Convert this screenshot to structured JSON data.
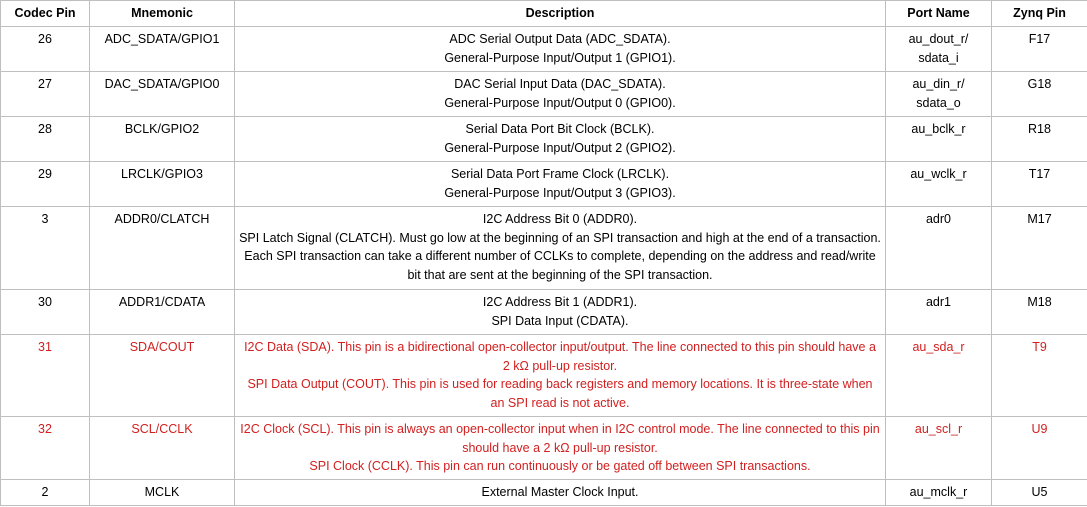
{
  "headers": [
    "Codec Pin",
    "Mnemonic",
    "Description",
    "Port Name",
    "Zynq Pin"
  ],
  "rows": [
    {
      "pin": "26",
      "mnemonic": "ADC_SDATA/GPIO1",
      "desc": [
        "ADC Serial Output Data (ADC_SDATA).",
        "General-Purpose Input/Output 1 (GPIO1)."
      ],
      "port": [
        "au_dout_r/",
        "sdata_i"
      ],
      "zynq": "F17",
      "highlight": false
    },
    {
      "pin": "27",
      "mnemonic": "DAC_SDATA/GPIO0",
      "desc": [
        "DAC Serial Input Data (DAC_SDATA).",
        "General-Purpose Input/Output 0 (GPIO0)."
      ],
      "port": [
        "au_din_r/",
        "sdata_o"
      ],
      "zynq": "G18",
      "highlight": false
    },
    {
      "pin": "28",
      "mnemonic": "BCLK/GPIO2",
      "desc": [
        "Serial Data Port Bit Clock (BCLK).",
        "General-Purpose Input/Output 2 (GPIO2)."
      ],
      "port": [
        "au_bclk_r"
      ],
      "zynq": "R18",
      "highlight": false
    },
    {
      "pin": "29",
      "mnemonic": "LRCLK/GPIO3",
      "desc": [
        "Serial Data Port Frame Clock (LRCLK).",
        "General-Purpose Input/Output 3 (GPIO3)."
      ],
      "port": [
        "au_wclk_r"
      ],
      "zynq": "T17",
      "highlight": false
    },
    {
      "pin": "3",
      "mnemonic": "ADDR0/CLATCH",
      "desc": [
        "I2C Address Bit 0 (ADDR0).",
        "SPI Latch Signal (CLATCH). Must go low at the beginning of an SPI transaction and high at the end of a transaction. Each SPI transaction can take a different number of CCLKs to complete, depending on the address and read/write bit that are sent at the beginning of the SPI transaction."
      ],
      "port": [
        "adr0"
      ],
      "zynq": "M17",
      "highlight": false
    },
    {
      "pin": "30",
      "mnemonic": "ADDR1/CDATA",
      "desc": [
        "I2C Address Bit 1 (ADDR1).",
        "SPI Data Input (CDATA)."
      ],
      "port": [
        "adr1"
      ],
      "zynq": "M18",
      "highlight": false
    },
    {
      "pin": "31",
      "mnemonic": "SDA/COUT",
      "desc": [
        "I2C Data (SDA). This pin is a bidirectional open-collector input/output. The line connected to this pin should have a 2 kΩ pull-up resistor.",
        "SPI Data Output (COUT). This pin is used for reading back registers and memory locations. It is three-state when an SPI read is not active."
      ],
      "port": [
        "au_sda_r"
      ],
      "zynq": "T9",
      "highlight": true
    },
    {
      "pin": "32",
      "mnemonic": "SCL/CCLK",
      "desc": [
        "I2C Clock (SCL). This pin is always an open-collector input when in I2C control mode. The line connected to this pin should have a 2 kΩ pull-up resistor.",
        "SPI Clock (CCLK). This pin can run continuously or be gated off between SPI transactions."
      ],
      "port": [
        "au_scl_r"
      ],
      "zynq": "U9",
      "highlight": true
    },
    {
      "pin": "2",
      "mnemonic": "MCLK",
      "desc": [
        "External Master Clock Input."
      ],
      "port": [
        "au_mclk_r"
      ],
      "zynq": "U5",
      "highlight": false
    }
  ],
  "colors": {
    "highlight_text": "#d21f1f",
    "border": "#bfbfbf"
  }
}
